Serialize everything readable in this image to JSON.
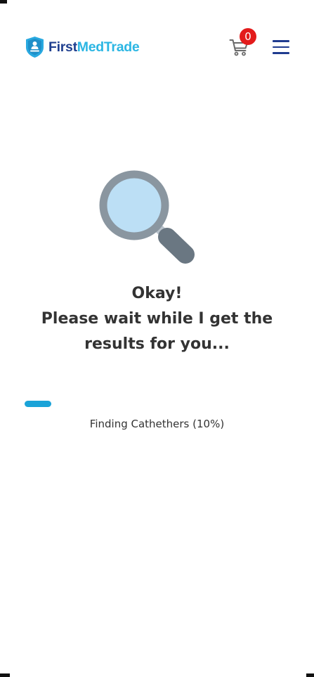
{
  "header": {
    "logo": {
      "text_first": "First",
      "text_second": "MedTrade",
      "icon": "shield-logo-icon",
      "colors": {
        "first": "#1f3f8f",
        "second": "#2bb6e3",
        "shield": "#29a9e0"
      }
    },
    "cart": {
      "icon": "cart-icon",
      "count": "0",
      "badge_color": "#e31b1b"
    },
    "menu": {
      "icon": "hamburger-menu-icon",
      "color": "#1f3b8f"
    }
  },
  "loading": {
    "illustration": "magnifying-glass-icon",
    "title": "Okay!",
    "line2": "Please wait while I get the",
    "line3": "results for you...",
    "progress": {
      "label": "Finding Cathethers (10%)",
      "percent": 10,
      "color": "#1aa3d8"
    }
  }
}
